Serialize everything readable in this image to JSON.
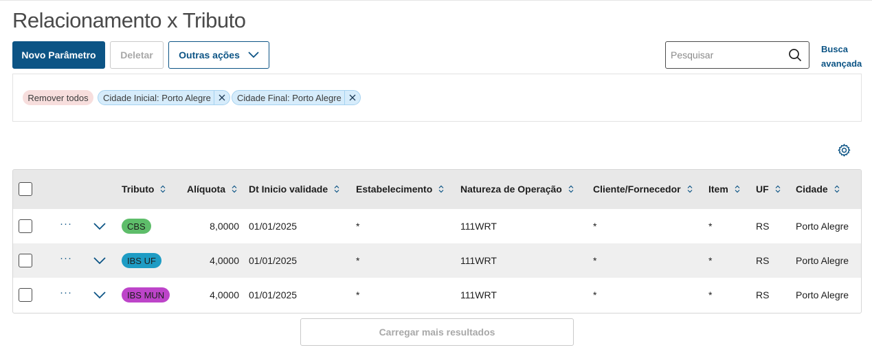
{
  "page": {
    "title": "Relacionamento x Tributo"
  },
  "toolbar": {
    "new_label": "Novo Parâmetro",
    "delete_label": "Deletar",
    "more_label": "Outras ações",
    "search_placeholder": "Pesquisar",
    "advanced_search_line1": "Busca",
    "advanced_search_line2": "avançada"
  },
  "filters": {
    "remove_all": "Remover todos",
    "chips": [
      "Cidade Inicial: Porto Alegre",
      "Cidade Final: Porto Alegre"
    ]
  },
  "table": {
    "headers": {
      "tributo": "Tributo",
      "aliquota": "Alíquota",
      "dt_inicio": "Dt Inicio validade",
      "estabelecimento": "Estabelecimento",
      "natureza": "Natureza de Operação",
      "cliente": "Cliente/Fornecedor",
      "item": "Item",
      "uf": "UF",
      "cidade": "Cidade"
    },
    "rows": [
      {
        "tributo": "CBS",
        "tag_color": "#5ebd6a",
        "aliquota": "8,0000",
        "dt_inicio": "01/01/2025",
        "estabelecimento": "*",
        "natureza": "111WRT",
        "cliente": "*",
        "item": "*",
        "uf": "RS",
        "cidade": "Porto Alegre"
      },
      {
        "tributo": "IBS UF",
        "tag_color": "#1e9cc4",
        "aliquota": "4,0000",
        "dt_inicio": "01/01/2025",
        "estabelecimento": "*",
        "natureza": "111WRT",
        "cliente": "*",
        "item": "*",
        "uf": "RS",
        "cidade": "Porto Alegre"
      },
      {
        "tributo": "IBS MUN",
        "tag_color": "#bd44c9",
        "aliquota": "4,0000",
        "dt_inicio": "01/01/2025",
        "estabelecimento": "*",
        "natureza": "111WRT",
        "cliente": "*",
        "item": "*",
        "uf": "RS",
        "cidade": "Porto Alegre"
      }
    ],
    "row_actions_glyph": "···"
  },
  "footer": {
    "load_more_label": "Carregar mais resultados"
  },
  "colors": {
    "primary": "#0c5485",
    "chip_remove_bg": "#f7dedd",
    "chip_filter_bg": "#d6ecfb"
  },
  "icons": [
    "chevron-down-icon",
    "search-icon",
    "close-icon",
    "gear-icon",
    "sort-icon",
    "more-actions-icon",
    "expand-icon"
  ]
}
